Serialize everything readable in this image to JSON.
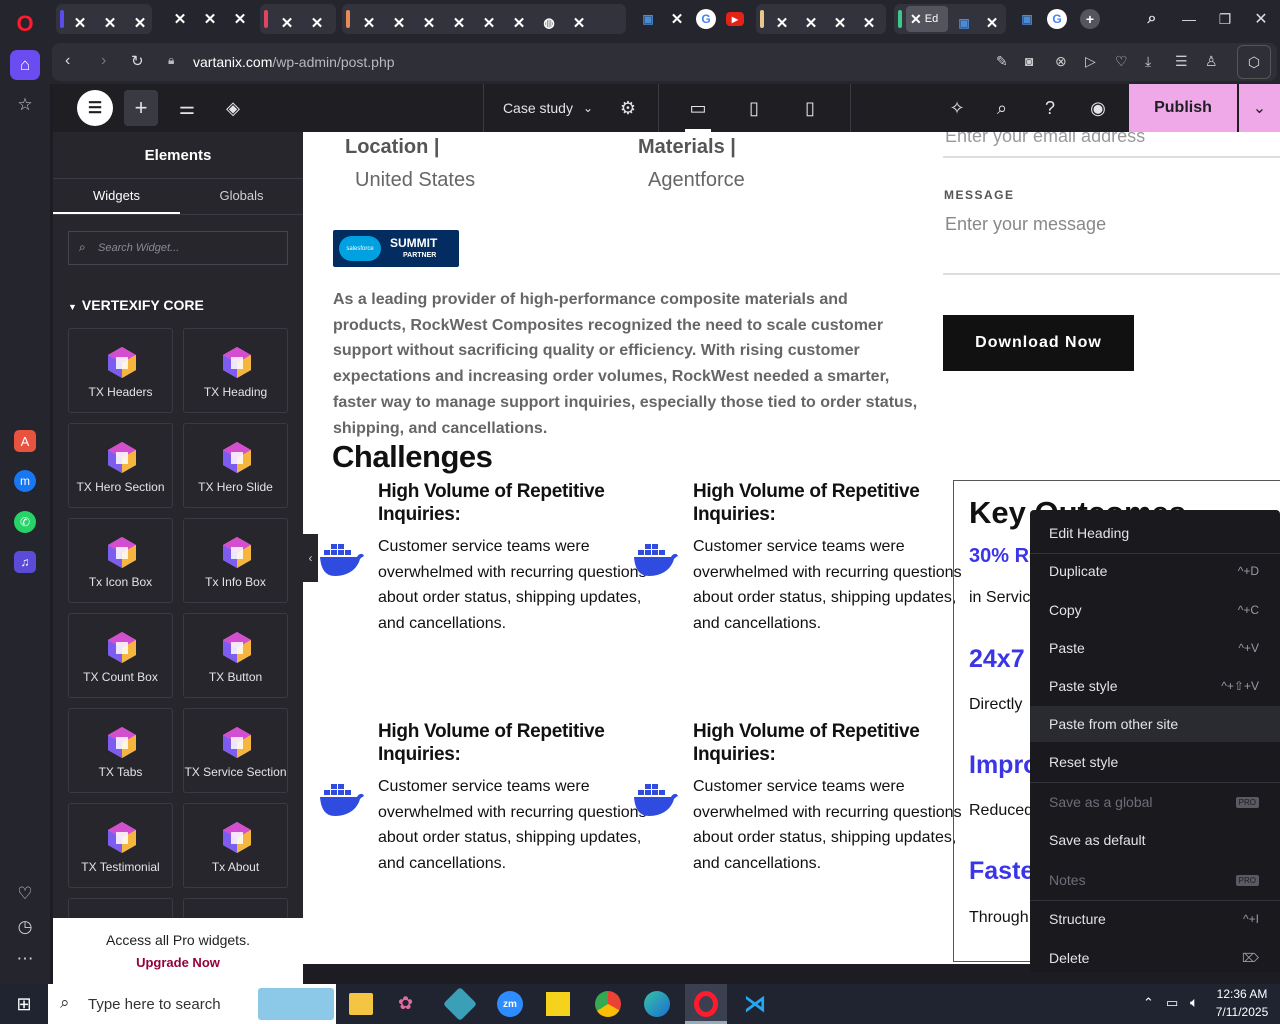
{
  "browser": {
    "url_domain": "vartanix.com",
    "url_path": "/wp-admin/post.php",
    "active_tab_label": "Ed"
  },
  "elementor": {
    "page_title": "Case study",
    "publish_label": "Publish",
    "panel_title": "Elements",
    "tab_widgets": "Widgets",
    "tab_globals": "Globals",
    "search_placeholder": "Search Widget...",
    "category": "VERTEXIFY CORE",
    "widgets": [
      "TX Headers",
      "TX Heading",
      "TX Hero Section",
      "TX Hero Slide",
      "Tx Icon Box",
      "Tx Info Box",
      "TX Count Box",
      "TX Button",
      "TX Tabs",
      "TX Service Section",
      "TX Testimonial",
      "Tx About"
    ],
    "promo_text": "Access all Pro widgets.",
    "promo_link": "Upgrade Now"
  },
  "page": {
    "location_label": "Location |",
    "location_value": "United States",
    "materials_label": "Materials |",
    "materials_value": "Agentforce",
    "badge_small": "salesforce",
    "badge_title": "SUMMIT",
    "badge_sub": "PARTNER",
    "intro": "As a leading provider of high-performance composite materials and products, RockWest Composites recognized the need to scale customer support without sacrificing quality or efficiency. With rising customer expectations and increasing order volumes, RockWest needed a smarter, faster way to manage support inquiries, especially those tied to order status, shipping, and cancellations.",
    "email_placeholder": "Enter your email address",
    "message_label": "MESSAGE",
    "message_placeholder": "Enter your message",
    "download_label": "Download Now",
    "challenges_title": "Challenges",
    "challenges": [
      {
        "title": "High Volume of Repetitive Inquiries:",
        "text": "Customer service teams were overwhelmed with recurring questions about order status, shipping updates, and cancellations."
      },
      {
        "title": "High Volume of Repetitive Inquiries:",
        "text": "Customer service teams were overwhelmed with recurring questions about order status, shipping updates, and cancellations."
      },
      {
        "title": "High Volume of Repetitive Inquiries:",
        "text": "Customer service teams were overwhelmed with recurring questions about order status, shipping updates, and cancellations."
      },
      {
        "title": "High Volume of Repetitive Inquiries:",
        "text": "Customer service teams were overwhelmed with recurring questions about order status, shipping updates, and cancellations."
      }
    ],
    "outcomes_title": "Key Outcomes",
    "outcomes": [
      {
        "stat": "30% Re",
        "desc": "in Servic"
      },
      {
        "stat": "24x7",
        "desc": "Directly"
      },
      {
        "stat": "Impro",
        "desc": "Reduced"
      },
      {
        "stat": "Faste",
        "desc": "Through"
      }
    ]
  },
  "context_menu": {
    "items": [
      {
        "label": "Edit Heading",
        "shortcut": ""
      },
      {
        "label": "Duplicate",
        "shortcut": "^+D"
      },
      {
        "label": "Copy",
        "shortcut": "^+C"
      },
      {
        "label": "Paste",
        "shortcut": "^+V"
      },
      {
        "label": "Paste style",
        "shortcut": "^+⇧+V"
      },
      {
        "label": "Paste from other site",
        "shortcut": ""
      },
      {
        "label": "Reset style",
        "shortcut": ""
      },
      {
        "label": "Save as a global",
        "shortcut": "",
        "badge": "PRO"
      },
      {
        "label": "Save as default",
        "shortcut": ""
      },
      {
        "label": "Notes",
        "shortcut": "",
        "badge": "PRO"
      },
      {
        "label": "Structure",
        "shortcut": "^+I"
      },
      {
        "label": "Delete",
        "shortcut": "⌦"
      }
    ]
  },
  "taskbar": {
    "search_placeholder": "Type here to search",
    "time": "12:36 AM",
    "date": "7/11/2025"
  },
  "colors": {
    "accent_blue": "#3b35e8",
    "publish_bg": "#f0a9e8",
    "panel_bg": "#26262c",
    "opera_red": "#ff1b2d"
  }
}
